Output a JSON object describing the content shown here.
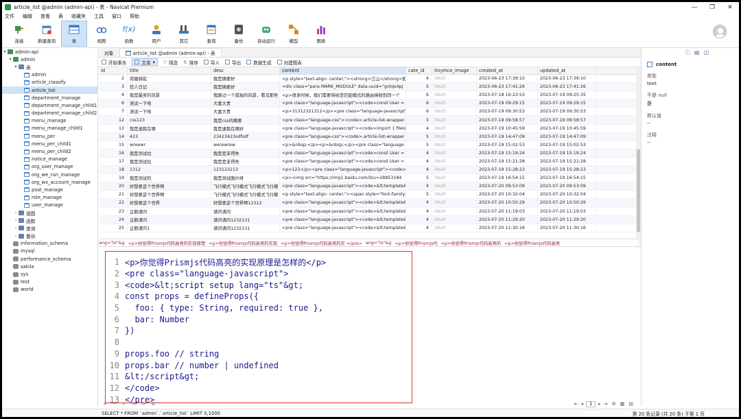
{
  "window": {
    "title": "article_list @admin (admin-api) - 表 - Navicat Premium"
  },
  "menu": [
    "文件",
    "编辑",
    "查看",
    "表",
    "收藏夹",
    "工具",
    "窗口",
    "帮助"
  ],
  "ribbon": [
    {
      "label": "连接",
      "icon": "plug-icon"
    },
    {
      "label": "新建查询",
      "icon": "new-query-icon"
    },
    {
      "label": "表",
      "icon": "table-icon",
      "active": true
    },
    {
      "label": "视图",
      "icon": "view-icon"
    },
    {
      "label": "函数",
      "icon": "function-icon"
    },
    {
      "label": "用户",
      "icon": "user-icon"
    },
    {
      "label": "其它",
      "icon": "tools-icon"
    },
    {
      "label": "查询",
      "icon": "query-icon"
    },
    {
      "label": "备份",
      "icon": "backup-icon"
    },
    {
      "label": "自动运行",
      "icon": "robot-icon"
    },
    {
      "label": "模型",
      "icon": "model-icon"
    },
    {
      "label": "图表",
      "icon": "chart-icon"
    }
  ],
  "tree": {
    "connection": "admin-api",
    "database": "admin",
    "tables_folder": "表",
    "tables": [
      "admin",
      "article_classify",
      "article_list",
      "department_manage",
      "department_manage_child1",
      "department_manage_child2",
      "menu_manage",
      "menu_manage_child1",
      "menu_per",
      "menu_per_child1",
      "menu_per_child2",
      "notice_manage",
      "org_user_manage",
      "org_we_run_manage",
      "org_wx_account_manage",
      "post_manage",
      "role_manage",
      "user_manage"
    ],
    "folders": [
      "视图",
      "函数",
      "查询",
      "备份"
    ],
    "other_dbs": [
      "information_schema",
      "mysql",
      "performance_schema",
      "sakila",
      "sys",
      "test",
      "world"
    ]
  },
  "tabs": {
    "objects": "对象",
    "active": "article_list @admin (admin-api) - 表"
  },
  "toolbar": {
    "begin_tx": "开始事务",
    "text": "文本",
    "filter": "筛选",
    "sort": "排序",
    "import": "导入",
    "export": "导出",
    "gen_data": "数据生成",
    "create_chart": "创建图表"
  },
  "grid": {
    "columns": [
      "id",
      "title",
      "desc",
      "content",
      "cate_id",
      "tinymce_image",
      "created_at",
      "updated_at"
    ],
    "rows": [
      [
        "2",
        "荷塘骑驼",
        "我是摘要好",
        "<p style=\"text-align: center;\"><strong>江山</strong>如",
        "4",
        "(Null)",
        "2023-06-23 17:39:10",
        "2023-06-23 17:39:10"
      ],
      [
        "3",
        "狂人日记",
        "我是摘要好",
        "<div class=\"para MARK_MODULE\" data-uuid=\"gntqs4pj",
        "5",
        "(Null)",
        "2023-06-23 17:41:26",
        "2023-06-23 17:41:26"
      ],
      [
        "4",
        "我是最美的风景",
        "我路过一个孤独的风景，看见那些",
        "<p>很多时候，我们需要将给定匹配模式的路由映射到同一个",
        "6",
        "(Null)",
        "2023-07-18 16:23:53",
        "2023-07-19 09:25:35"
      ],
      [
        "6",
        "测试一下哈",
        "大富大贵",
        "<pre class=\"language-javascript\"><code>const User =",
        "6",
        "(Null)",
        "2023-07-19 09:29:15",
        "2023-07-19 09:29:15"
      ],
      [
        "7",
        "测试一下哈",
        "大富大贵",
        "<p>31312321312</p><pre class=\"language-javascript\"",
        "6",
        "(Null)",
        "2023-07-19 09:30:53",
        "2023-07-19 09:30:53"
      ],
      [
        "12",
        "css123",
        "我是css的摘要",
        "<pre class=\"language-css\"><code>.article-list-wrapper",
        "5",
        "(Null)",
        "2023-07-19 09:58:57",
        "2023-07-19 09:58:57"
      ],
      [
        "13",
        "我是速我在哪",
        "我是速我在哪好",
        "<pre class=\"language-javascript\"><code>import { fileU",
        "4",
        "(Null)",
        "2023-07-19 10:45:59",
        "2023-07-19 10:45:59"
      ],
      [
        "14",
        "423",
        "23423423sdfsdf",
        "<pre class=\"language-css\"><code>.article-list-wrapper",
        "5",
        "(Null)",
        "2023-07-19 14:47:09",
        "2023-07-19 14:47:09"
      ],
      [
        "15",
        "wreewr",
        "werewrew",
        "<p>&nbsp;</p><p>&nbsp;</p><pre class=\"language",
        "5",
        "(Null)",
        "2023-07-19 15:02:53",
        "2023-07-19 15:02:53"
      ],
      [
        "16",
        "我是测试拉",
        "我是是非得失",
        "<pre class=\"language-javascript\"><code>const User =",
        "4",
        "(Null)",
        "2023-07-19 15:19:24",
        "2023-07-19 15:19:24"
      ],
      [
        "17",
        "我是测试拉",
        "我是是非得失",
        "<pre class=\"language-javascript\"><code>const User =",
        "4",
        "(Null)",
        "2023-07-19 15:21:28",
        "2023-07-19 15:21:28"
      ],
      [
        "18",
        "1312",
        "123123213",
        "<p>123</p><pre class=\"language-javascript\"><code>",
        "4",
        "(Null)",
        "2023-07-19 15:28:23",
        "2023-07-19 15:28:23"
      ],
      [
        "19",
        "我是测试的",
        "我是测试图片呀",
        "<p><img src=\"https://img1.baidu.com/it/u=28853184",
        "5",
        "(Null)",
        "2023-07-19 16:54:15",
        "2023-07-19 16:54:15"
      ],
      [
        "20",
        "好想要这个世界啊",
        "飞行模式飞行模式飞行模式飞行模",
        "<pre class=\"language-javascript\"><code>&lt;template&",
        "4",
        "(Null)",
        "2023-07-20 09:53:09",
        "2023-07-20 09:53:09"
      ],
      [
        "21",
        "好想要这个世界啊",
        "飞行模式飞行模式飞行模式飞行模",
        "<p style=\"text-align: center;\"><span style=\"font-family:",
        "5",
        "(Null)",
        "2023-07-20 10:32:04",
        "2023-07-20 10:32:04"
      ],
      [
        "22",
        "好想要这个世界",
        "好想要这个世界啊12312",
        "<pre class=\"language-javascript\"><code>&lt;template&",
        "4",
        "(Null)",
        "2023-07-20 10:50:29",
        "2023-07-20 10:50:29"
      ],
      [
        "23",
        "企鹅请问",
        "请问请问",
        "<pre class=\"language-javascript\"><code>&lt;template&",
        "4",
        "(Null)",
        "2023-07-20 11:19:03",
        "2023-07-20 11:19:03"
      ],
      [
        "24",
        "企鹅请问",
        "请问请问1232131",
        "<pre class=\"language-javascript\"><code>&lt;template&",
        "4",
        "(Null)",
        "2023-07-20 11:29:20",
        "2023-07-20 11:29:20"
      ],
      [
        "25",
        "企鹅请问1",
        "请问请问1232131",
        "<pre class=\"language-javascript\"><code>&lt;template&",
        "4",
        "(Null)",
        "2023-07-20 11:30:16",
        "2023-07-20 11:30:16"
      ]
    ],
    "last_row_parts": [
      "ang=\"ts\"&g",
      "<p>你觉得Prismjs代码高亮的实现原理",
      "<p>你觉得Prismjs代码高亮的实现",
      "<p>你觉得Prismjs代码高亮的实 </pre>",
      "ang=\"ts\"&g",
      "<p>你觉得Prismjs代",
      "<p>你觉得Prismjs代码高亮的",
      "<p>你觉得Prismjs代码高亮"
    ]
  },
  "editor": {
    "lines": [
      {
        "n": "1",
        "t": "<p>你觉得Prismjs代码高亮的实现原理是怎样的</p>"
      },
      {
        "n": "2",
        "t": "<pre class=\"language-javascript\">"
      },
      {
        "n": "3",
        "t": "<code>&lt;script setup lang=\"ts\"&gt;"
      },
      {
        "n": "4",
        "t": "const props = defineProps({"
      },
      {
        "n": "5",
        "t": "  foo: { type: String, required: true },"
      },
      {
        "n": "6",
        "t": "  bar: Number"
      },
      {
        "n": "7",
        "t": "})"
      },
      {
        "n": "8",
        "t": ""
      },
      {
        "n": "9",
        "t": "props.foo // string"
      },
      {
        "n": "10",
        "t": "props.bar // number | undefined"
      },
      {
        "n": "11",
        "t": "&lt;/script&gt;"
      },
      {
        "n": "12",
        "t": "</code>"
      },
      {
        "n": "13",
        "t": "</pre>"
      }
    ]
  },
  "nav": {
    "page": "1"
  },
  "right_panel": {
    "field": "content",
    "type_label": "类型",
    "type_value": "text",
    "notnull_label": "不是 null",
    "notnull_value": "是",
    "default_label": "默认值",
    "default_value": "--",
    "comment_label": "注释",
    "comment_value": "--"
  },
  "status": {
    "sql": "SELECT * FROM `admin`.`article_list` LIMIT 0,1000",
    "records": "第 20 条记录 (共 20 条) 于第 1 页"
  }
}
